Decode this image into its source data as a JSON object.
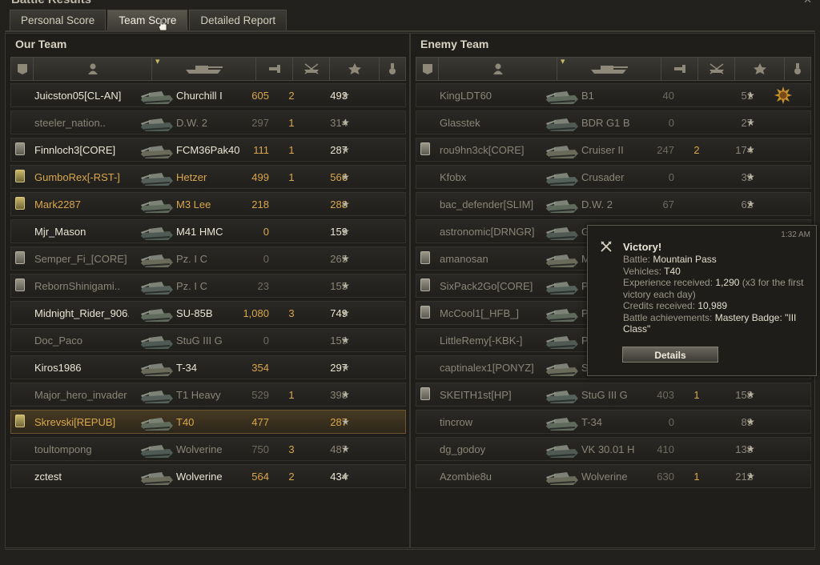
{
  "window": {
    "title": "Battle Results",
    "close_glyph": "✕"
  },
  "tabs": [
    {
      "label": "Personal Score",
      "active": false
    },
    {
      "label": "Team Score",
      "active": true
    },
    {
      "label": "Detailed Report",
      "active": false
    }
  ],
  "columns": {
    "badge": "badge-icon",
    "player": "player-icon",
    "vehicle": "tank-icon",
    "damage": "damage-icon",
    "kills": "kills-icon",
    "xp": "star-icon",
    "medal": "medal-icon"
  },
  "our_team": {
    "title": "Our Team",
    "rows": [
      {
        "name": "Juicston05[CL-AN]",
        "vehicle": "Churchill I",
        "damage": "605",
        "kills": "2",
        "xp": "493",
        "badge": "",
        "style": "bright"
      },
      {
        "name": "steeler_nation..",
        "vehicle": "D.W. 2",
        "damage": "297",
        "kills": "1",
        "xp": "314",
        "badge": "",
        "style": "dim"
      },
      {
        "name": "Finnloch3[CORE]",
        "vehicle": "FCM36Pak40",
        "damage": "111",
        "kills": "1",
        "xp": "287",
        "badge": "silver",
        "style": "bright"
      },
      {
        "name": "GumboRex[-RST-]",
        "vehicle": "Hetzer",
        "damage": "499",
        "kills": "1",
        "xp": "566",
        "badge": "gold",
        "style": "gold"
      },
      {
        "name": "Mark2287",
        "vehicle": "M3 Lee",
        "damage": "218",
        "kills": "",
        "xp": "288",
        "badge": "gold",
        "style": "gold"
      },
      {
        "name": "Mjr_Mason",
        "vehicle": "M41 HMC",
        "damage": "0",
        "kills": "",
        "xp": "159",
        "badge": "",
        "style": "bright"
      },
      {
        "name": "Semper_Fi_[CORE]",
        "vehicle": "Pz. I C",
        "damage": "0",
        "kills": "",
        "xp": "265",
        "badge": "silver",
        "style": "dim"
      },
      {
        "name": "RebornShinigami..",
        "vehicle": "Pz. I C",
        "damage": "23",
        "kills": "",
        "xp": "155",
        "badge": "silver",
        "style": "dim"
      },
      {
        "name": "Midnight_Rider_906..",
        "vehicle": "SU-85B",
        "damage": "1,080",
        "kills": "3",
        "xp": "749",
        "badge": "",
        "style": "bright"
      },
      {
        "name": "Doc_Paco",
        "vehicle": "StuG III G",
        "damage": "0",
        "kills": "",
        "xp": "159",
        "badge": "",
        "style": "dim"
      },
      {
        "name": "Kiros1986",
        "vehicle": "T-34",
        "damage": "354",
        "kills": "",
        "xp": "297",
        "badge": "",
        "style": "bright"
      },
      {
        "name": "Major_hero_invader",
        "vehicle": "T1 Heavy",
        "damage": "529",
        "kills": "1",
        "xp": "398",
        "badge": "",
        "style": "dim"
      },
      {
        "name": "Skrevski[REPUB]",
        "vehicle": "T40",
        "damage": "477",
        "kills": "",
        "xp": "287",
        "badge": "gold",
        "style": "gold hl"
      },
      {
        "name": "toultompong",
        "vehicle": "Wolverine",
        "damage": "750",
        "kills": "3",
        "xp": "487",
        "badge": "",
        "style": "dim"
      },
      {
        "name": "zctest",
        "vehicle": "Wolverine",
        "damage": "564",
        "kills": "2",
        "xp": "434",
        "badge": "",
        "style": "bright"
      }
    ]
  },
  "enemy_team": {
    "title": "Enemy Team",
    "rows": [
      {
        "name": "KingLDT60",
        "vehicle": "B1",
        "damage": "40",
        "kills": "",
        "xp": "51",
        "badge": "",
        "style": "dim",
        "medal": true
      },
      {
        "name": "Glasstek",
        "vehicle": "BDR G1 B",
        "damage": "0",
        "kills": "",
        "xp": "27",
        "badge": "",
        "style": "dim"
      },
      {
        "name": "rou9hn3ck[CORE]",
        "vehicle": "Cruiser II",
        "damage": "247",
        "kills": "2",
        "xp": "174",
        "badge": "silver",
        "style": "dim"
      },
      {
        "name": "Kfobx",
        "vehicle": "Crusader",
        "damage": "0",
        "kills": "",
        "xp": "39",
        "badge": "",
        "style": "dim"
      },
      {
        "name": "bac_defender[SLIM]",
        "vehicle": "D.W. 2",
        "damage": "67",
        "kills": "",
        "xp": "62",
        "badge": "",
        "style": "dim"
      },
      {
        "name": "astronomic[DRNGR]",
        "vehicle": "G",
        "damage": "",
        "kills": "",
        "xp": "",
        "badge": "",
        "style": "dim"
      },
      {
        "name": "amanosan",
        "vehicle": "M",
        "damage": "",
        "kills": "",
        "xp": "",
        "badge": "silver",
        "style": "dim"
      },
      {
        "name": "SixPack2Go[CORE]",
        "vehicle": "P",
        "damage": "",
        "kills": "",
        "xp": "",
        "badge": "silver",
        "style": "dim"
      },
      {
        "name": "McCool1[_HFB_]",
        "vehicle": "P",
        "damage": "",
        "kills": "",
        "xp": "",
        "badge": "silver",
        "style": "dim"
      },
      {
        "name": "LittleRemy[-KBK-]",
        "vehicle": "P",
        "damage": "",
        "kills": "",
        "xp": "",
        "badge": "",
        "style": "dim"
      },
      {
        "name": "captinalex1[PONYZ]",
        "vehicle": "S",
        "damage": "",
        "kills": "",
        "xp": "",
        "badge": "",
        "style": "dim"
      },
      {
        "name": "SKEITH1st[HP]",
        "vehicle": "StuG III G",
        "damage": "403",
        "kills": "1",
        "xp": "158",
        "badge": "silver",
        "style": "dim"
      },
      {
        "name": "tincrow",
        "vehicle": "T-34",
        "damage": "0",
        "kills": "",
        "xp": "89",
        "badge": "",
        "style": "dim"
      },
      {
        "name": "dg_godoy",
        "vehicle": "VK 30.01 H",
        "damage": "410",
        "kills": "",
        "xp": "138",
        "badge": "",
        "style": "dim"
      },
      {
        "name": "Azombie8u",
        "vehicle": "Wolverine",
        "damage": "630",
        "kills": "1",
        "xp": "212",
        "badge": "",
        "style": "dim"
      }
    ]
  },
  "tooltip": {
    "time": "1:32 AM",
    "title": "Victory!",
    "lines": [
      {
        "label": "Battle: ",
        "value": "Mountain Pass"
      },
      {
        "label": "Vehicles: ",
        "value": "T40"
      },
      {
        "label": "Experience received: ",
        "value": "1,290",
        "suffix": " (x3 for the first victory each day)"
      },
      {
        "label": "Credits received: ",
        "value": "10,989"
      },
      {
        "label": "Battle achievements: ",
        "value": "Mastery Badge: \"III Class\""
      }
    ],
    "button_label": "Details"
  },
  "star_glyph": "★"
}
